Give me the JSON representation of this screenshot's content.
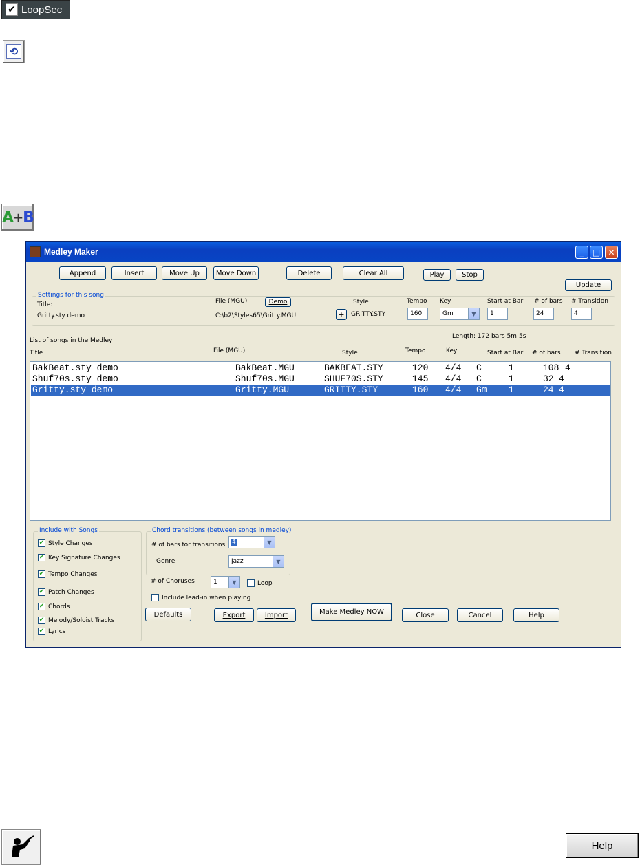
{
  "top": {
    "loopsec_label": "LoopSec",
    "loopsec_checked": true,
    "loop_icon": "loop-arrows-icon",
    "ab_a": "A",
    "ab_plus": "+",
    "ab_b": "B"
  },
  "dialog": {
    "title": "Medley Maker",
    "toolbar": {
      "append": "Append",
      "insert": "Insert",
      "move_up": "Move Up",
      "move_down": "Move Down",
      "delete": "Delete",
      "clear_all": "Clear All",
      "play": "Play",
      "stop": "Stop",
      "update": "Update"
    },
    "settings": {
      "group_label": "Settings for this song",
      "title_label": "Title:",
      "title_value": "Gritty.sty demo",
      "file_label": "File (MGU)",
      "demo": "Demo",
      "file_value": "C:\\b2\\Styles65\\Gritty.MGU",
      "style_label": "Style",
      "plus": "+",
      "style_value": "GRITTY.STY",
      "tempo_label": "Tempo",
      "tempo_value": "160",
      "key_label": "Key",
      "key_value": "Gm",
      "start_label": "Start at Bar",
      "start_value": "1",
      "bars_label": "# of bars",
      "bars_value": "24",
      "transition_label": "# Transition",
      "transition_value": "4"
    },
    "list": {
      "length_text": "Length:  172 bars  5m:5s",
      "caption": "List of songs in the Medley",
      "headers": {
        "title": "Title",
        "file": "File (MGU)",
        "style": "Style",
        "tempo": "Tempo",
        "key": "Key",
        "start": "Start at Bar",
        "bars": "# of bars",
        "transition": "# Transition"
      },
      "rows": [
        {
          "title": "BakBeat.sty demo",
          "file": "BakBeat.MGU",
          "style": "BAKBEAT.STY",
          "tempo": "120",
          "sig": "4/4",
          "key": "C",
          "start": "1",
          "bars": "108",
          "trans": "4"
        },
        {
          "title": "Shuf70s.sty demo",
          "file": "Shuf70s.MGU",
          "style": "SHUF70S.STY",
          "tempo": "145",
          "sig": "4/4",
          "key": "C",
          "start": "1",
          "bars": "32",
          "trans": "4"
        },
        {
          "title": "Gritty.sty demo",
          "file": "Gritty.MGU",
          "style": "GRITTY.STY",
          "tempo": "160",
          "sig": "4/4",
          "key": "Gm",
          "start": "1",
          "bars": "24",
          "trans": "4"
        }
      ]
    },
    "include": {
      "group_label": "Include with Songs",
      "items": [
        "Style Changes",
        "Key Signature Changes",
        "Tempo Changes",
        "Patch Changes",
        "Chords",
        "Melody/Soloist Tracks",
        "Lyrics"
      ]
    },
    "transitions": {
      "group_label": "Chord transitions (between songs in medley)",
      "bars_label": "# of bars for transitions",
      "bars_value": "4",
      "genre_label": "Genre",
      "genre_value": "Jazz"
    },
    "choruses_label": "# of Choruses",
    "choruses_value": "1",
    "loop_label": "Loop",
    "leadin_label": "Include lead-in when playing",
    "bottom": {
      "defaults": "Defaults",
      "export": "Export",
      "import": "Import",
      "make": "Make Medley NOW",
      "close": "Close",
      "cancel": "Cancel",
      "help": "Help"
    }
  },
  "bottom_help": "Help",
  "conductor_icon": "conductor-icon"
}
